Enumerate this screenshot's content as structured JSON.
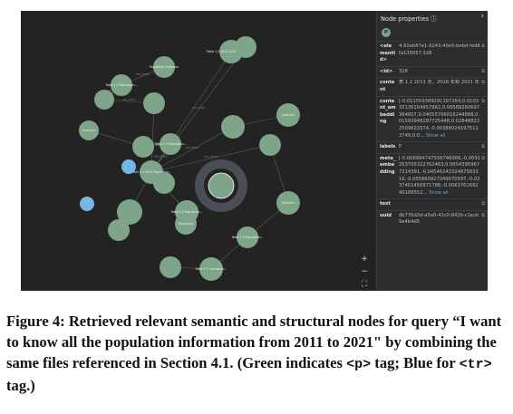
{
  "graph": {
    "colors": {
      "p_node": "#7ea58a",
      "tr_node": "#73b7e6",
      "edge": "#5b5f5c",
      "ring": "#4a4f55"
    },
    "nodes": [
      {
        "label": "Table 1.2 2011-2016 Population ..."
      },
      {
        "label": ""
      },
      {
        "label": "Population Statistics"
      },
      {
        "label": "Table 1.4 Population..."
      },
      {
        "label": ""
      },
      {
        "label": ""
      },
      {
        "label": "Overview"
      },
      {
        "label": ""
      },
      {
        "label": "Table 1.3 Population..."
      },
      {
        "label": "Statistics"
      },
      {
        "label": ""
      },
      {
        "label": ""
      },
      {
        "label": "Table 1.1 2011 Population..."
      },
      {
        "label": ""
      },
      {
        "label": ""
      },
      {
        "label": "Table 1.5 Population..."
      },
      {
        "label": ""
      },
      {
        "label": "Statistics"
      },
      {
        "label": "Population"
      },
      {
        "label": "Table 1.6 Population..."
      },
      {
        "label": "Table 1.7 Population..."
      },
      {
        "label": ""
      }
    ],
    "edge_labels": [
      "HAS_CHILD",
      "HAS_CHILD",
      "HAS_CHILD",
      "HAS_CHILD",
      "HAS_CHILD",
      "HAS_CHILD",
      "HAS_CHILD",
      "HAS_CHILD"
    ]
  },
  "zoom": {
    "zoom_in": "+",
    "zoom_out": "−",
    "fit": "⛶"
  },
  "panel": {
    "title": "Node properties ⓘ",
    "expand": "›",
    "tag": "P",
    "rows": [
      {
        "key": "<elementId>",
        "value": "4:92eb87e1-9143-40e5-bebd-fa98fa135057:328"
      },
      {
        "key": "<id>",
        "value": "328"
      },
      {
        "key": "content",
        "value": "表 1.2  2011 年，2016 年和 2021 年"
      },
      {
        "key": "content_embedding",
        "value": "[-0.011559389291167264,0.010335136204957962,0.06589260697364807,0.04055766016244888,0.01592948287725448,0.028488222509622574,-0.003890241975113749,0.0...",
        "more": " Show all"
      },
      {
        "key": "labels",
        "value": "P"
      },
      {
        "key": "meta_embedding",
        "value": "[-0.006994747556746006,-0.0091253705322762463,0.06543959677214391,-0.0454624332487583316,-0.005860927049070597,-0.0237451456871788,-0.006376168240189552...",
        "more": " Show all"
      },
      {
        "key": "text",
        "value": ""
      },
      {
        "key": "uuid",
        "value": "db735d2d-a5a0-41c0-842b-c1ecb9a4b4d5"
      }
    ],
    "copy_icon": "⧉"
  },
  "caption": {
    "part1": "Figure 4: Retrieved relevant semantic and structural nodes for query “I want to know all the population information from 2011 to 2021\" by combining the same files referenced in Section 4.1. (Green indicates ",
    "code_p": "<p>",
    "part2": " tag; Blue for ",
    "code_tr": "<tr>",
    "part3": " tag.)"
  }
}
